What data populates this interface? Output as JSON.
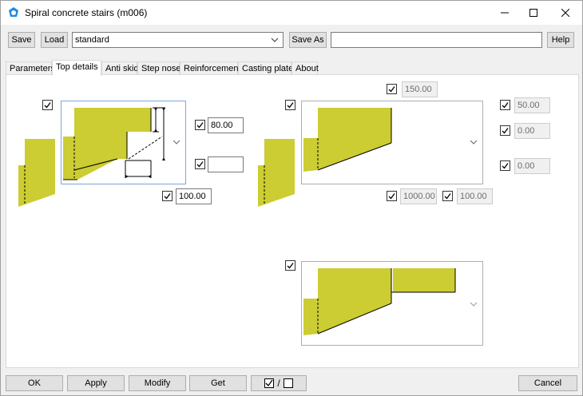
{
  "window": {
    "title": "Spiral concrete stairs (m006)",
    "minimize": "—",
    "maximize": "☐",
    "close": "✕"
  },
  "toolbar": {
    "save_label": "Save",
    "load_label": "Load",
    "preset_value": "standard",
    "save_as_label": "Save As",
    "save_as_value": "",
    "help_label": "Help"
  },
  "tabs": [
    {
      "label": "Parameters"
    },
    {
      "label": "Top details"
    },
    {
      "label": "Anti skid"
    },
    {
      "label": "Step nose"
    },
    {
      "label": "Reinforcement"
    },
    {
      "label": "Casting plates"
    },
    {
      "label": "About"
    }
  ],
  "top_details": {
    "left": {
      "field_a": "80.00",
      "field_b": "",
      "field_c": "100.00"
    },
    "right": {
      "top_field": "150.00",
      "side_1": "50.00",
      "side_2": "0.00",
      "side_3": "0.00",
      "bottom_1": "1000.00",
      "bottom_2": "100.00"
    }
  },
  "bottom": {
    "ok_label": "OK",
    "apply_label": "Apply",
    "modify_label": "Modify",
    "get_label": "Get",
    "toggle_label": "/",
    "cancel_label": "Cancel"
  },
  "colors": {
    "fill": "#cccc33",
    "accent": "#0078d7"
  }
}
